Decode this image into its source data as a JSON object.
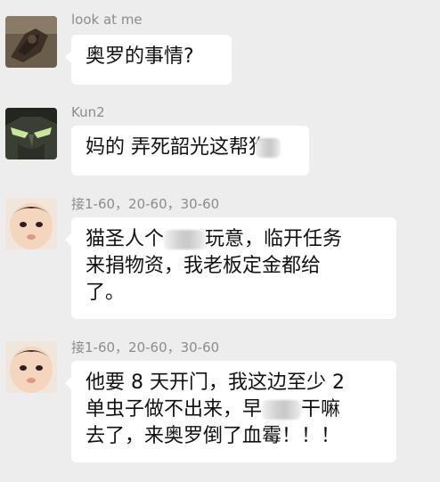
{
  "messages": [
    {
      "sender": "look at me",
      "avatar": "hand-photo-avatar",
      "lines": [
        "奥罗的事情?"
      ]
    },
    {
      "sender": "Kun2",
      "avatar": "illidan-avatar",
      "line_a": "妈的 弄死韶光这帮",
      "line_a_trunc": "狗"
    },
    {
      "sender": "接1-60，20-60，30-60",
      "avatar": "baby-avatar",
      "line1_a": "猫圣人个",
      "line1_b": "玩意，临开任务",
      "line2": "来捐物资，我老板定金都给",
      "line3": "了。"
    },
    {
      "sender": "接1-60，20-60，30-60",
      "avatar": "baby-avatar",
      "line1": "他要 8 天开门，我这边至少 2",
      "line2_a": "单虫子做不出来，早",
      "line2_b": "干嘛",
      "line3": "去了，来奥罗倒了血霉！！！"
    }
  ]
}
